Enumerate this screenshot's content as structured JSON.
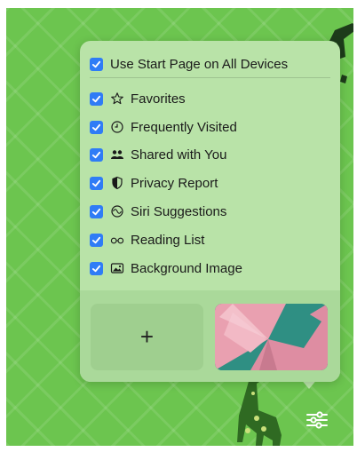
{
  "popover": {
    "header": {
      "label": "Use Start Page on All Devices",
      "checked": true
    },
    "items": [
      {
        "label": "Favorites",
        "icon": "star-icon",
        "checked": true
      },
      {
        "label": "Frequently Visited",
        "icon": "clock-icon",
        "checked": true
      },
      {
        "label": "Shared with You",
        "icon": "people-icon",
        "checked": true
      },
      {
        "label": "Privacy Report",
        "icon": "shield-icon",
        "checked": true
      },
      {
        "label": "Siri Suggestions",
        "icon": "siri-icon",
        "checked": true
      },
      {
        "label": "Reading List",
        "icon": "glasses-icon",
        "checked": true
      },
      {
        "label": "Background Image",
        "icon": "photo-icon",
        "checked": true
      }
    ],
    "add_tile_label": "+"
  },
  "colors": {
    "background": "#6cc54f",
    "popover": "#b9e3a8",
    "checkbox": "#2f7cf6"
  }
}
